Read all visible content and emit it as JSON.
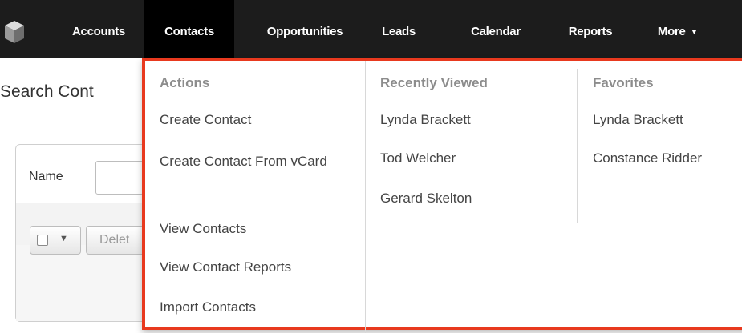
{
  "nav": {
    "logo_icon": "cube-logo-icon",
    "items": [
      {
        "label": "Accounts"
      },
      {
        "label": "Contacts"
      },
      {
        "label": "Opportunities"
      },
      {
        "label": "Leads"
      },
      {
        "label": "Calendar"
      },
      {
        "label": "Reports"
      },
      {
        "label": "More"
      }
    ],
    "active_item": "Contacts",
    "more_caret_icon": "caret-down-icon"
  },
  "page": {
    "title": "Search Cont",
    "filter_label": "Name",
    "delete_label": "Delet"
  },
  "dropdown": {
    "border_color": "#e8391e",
    "actions": {
      "heading": "Actions",
      "items": [
        {
          "label": "Create Contact"
        },
        {
          "label": "Create Contact From vCard"
        },
        {
          "label": "View Contacts"
        },
        {
          "label": "View Contact Reports"
        },
        {
          "label": "Import Contacts"
        }
      ]
    },
    "recently_viewed": {
      "heading": "Recently Viewed",
      "items": [
        {
          "label": "Lynda Brackett"
        },
        {
          "label": "Tod Welcher"
        },
        {
          "label": "Gerard Skelton"
        }
      ]
    },
    "favorites": {
      "heading": "Favorites",
      "items": [
        {
          "label": "Lynda Brackett"
        },
        {
          "label": "Constance Ridder"
        }
      ]
    }
  }
}
